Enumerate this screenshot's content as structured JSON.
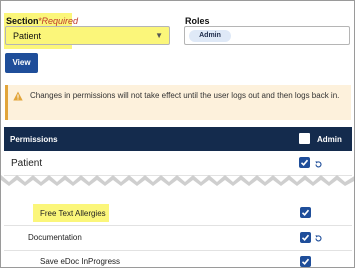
{
  "section": {
    "label": "Section",
    "required": "*Required",
    "selected": "Patient"
  },
  "roles": {
    "label": "Roles",
    "chips": [
      "Admin"
    ]
  },
  "view_button": "View",
  "alert": {
    "text": "Changes in permissions will not take effect until the user logs out and then logs back in."
  },
  "permissions": {
    "header": "Permissions",
    "admin_label": "Admin",
    "admin_checked": false,
    "rows": [
      {
        "label": "Patient",
        "checked": true
      },
      {
        "label": "Free Text Allergies",
        "checked": true
      },
      {
        "label": "Documentation",
        "checked": true
      },
      {
        "label": "Save eDoc InProgress",
        "checked": true
      }
    ]
  },
  "colors": {
    "highlight": "#fbf67a",
    "header_bg": "#142b4d",
    "primary": "#1f4e9a",
    "alert_bg": "#fdf1dc",
    "alert_accent": "#e2a53a"
  }
}
